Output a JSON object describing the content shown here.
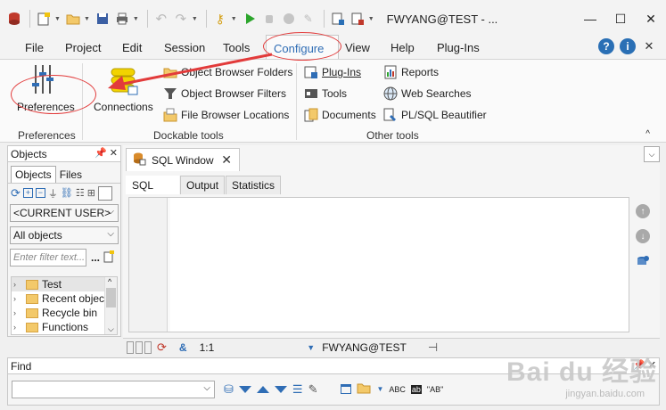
{
  "window": {
    "title": "FWYANG@TEST - ...",
    "controls": [
      "minimize-icon",
      "maximize-icon",
      "close-icon"
    ]
  },
  "menubar": {
    "items": [
      "File",
      "Project",
      "Edit",
      "Session",
      "Tools",
      "Configure",
      "View",
      "Help",
      "Plug-Ins"
    ],
    "active": "Configure"
  },
  "ribbon": {
    "preferences": {
      "label": "Preferences",
      "group": "Preferences"
    },
    "connections": {
      "label": "Connections"
    },
    "dockable": {
      "group": "Dockable tools",
      "items": [
        "Object Browser Folders",
        "Object Browser Filters",
        "File Browser Locations"
      ]
    },
    "other": {
      "group": "Other tools",
      "col1": [
        "Plug-Ins",
        "Tools",
        "Documents"
      ],
      "col2": [
        "Reports",
        "Web Searches",
        "PL/SQL Beautifier"
      ]
    }
  },
  "objects_panel": {
    "title": "Objects",
    "tabs": [
      "Objects",
      "Files"
    ],
    "user_combo": "<CURRENT USER>",
    "filter_combo": "All objects",
    "filter_placeholder": "Enter filter text...",
    "more_label": "...",
    "tree": [
      "Test",
      "Recent objects",
      "Recycle bin",
      "Functions"
    ]
  },
  "sql_window": {
    "tab_label": "SQL Window",
    "sub_tabs": [
      "SQL",
      "Output",
      "Statistics"
    ],
    "status": {
      "amp": "&",
      "position": "1:1",
      "connection": "FWYANG@TEST"
    }
  },
  "find_panel": {
    "title": "Find",
    "abc_label": "ABC",
    "ab_label": "\"AB\""
  },
  "watermark": {
    "main": "Bai du 经验",
    "sub": "jingyan.baidu.com"
  },
  "colors": {
    "accent": "#2f6db5",
    "annotation": "#e23b3b",
    "folder": "#f3c96a"
  }
}
